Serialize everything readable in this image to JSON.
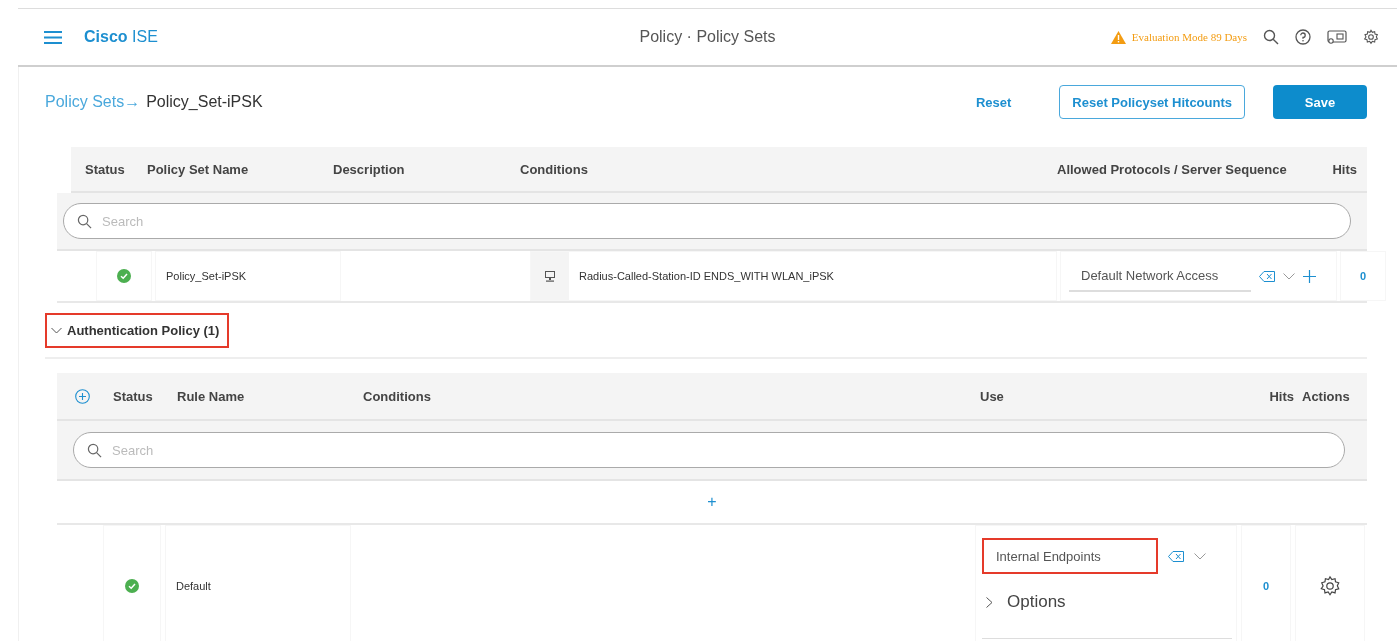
{
  "header": {
    "brand_bold": "Cisco",
    "brand": "ISE",
    "title": "Policy · Policy Sets",
    "evaluation": "Evaluation Mode 89 Days"
  },
  "breadcrumb": {
    "parent": "Policy Sets→",
    "current": "Policy_Set-iPSK"
  },
  "actions": {
    "reset": "Reset",
    "reset_hitcounts": "Reset Policyset Hitcounts",
    "save": "Save"
  },
  "policy_sets": {
    "columns": [
      "Status",
      "Policy Set Name",
      "Description",
      "Conditions",
      "Allowed Protocols / Server Sequence",
      "Hits"
    ],
    "search": {
      "placeholder": "Search"
    },
    "rows": [
      {
        "enabled": true,
        "name": "Policy_Set-iPSK",
        "condition": {
          "attribute": "Radius-Called-Station-ID",
          "operator": "ENDS_WITH",
          "value": "WLAN_iPSK"
        },
        "protocols": "Default Network Access",
        "hits": "0"
      }
    ]
  },
  "authentication_policy": {
    "title": "Authentication Policy (1)",
    "expanded": true,
    "highlighted": true,
    "columns": [
      "Status",
      "Rule Name",
      "Conditions",
      "Use",
      "Hits",
      "Actions"
    ],
    "search": {
      "placeholder": "Search"
    },
    "add_row": "+",
    "rules": [
      {
        "enabled": true,
        "name": "Default",
        "use": "Internal Endpoints",
        "use_highlighted": true,
        "options": "Options",
        "options_expanded": false,
        "hits": "0"
      }
    ]
  }
}
